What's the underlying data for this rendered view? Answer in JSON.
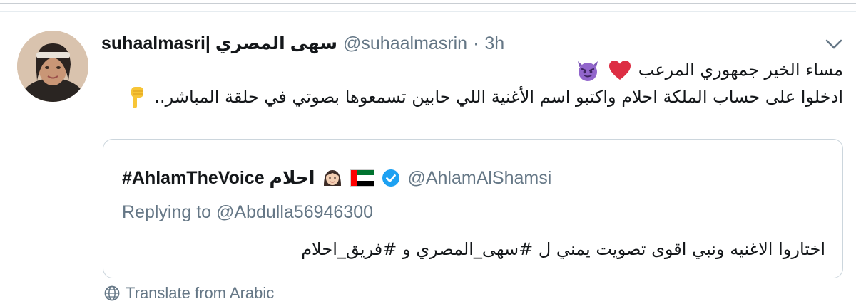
{
  "tweet": {
    "display_name": "suhaalmasri| سهى المصري",
    "handle": "@suhaalmasrin",
    "separator": "·",
    "time": "3h",
    "line1": "مساء الخير جمهوري المرعب",
    "line2": "ادخلوا على حساب الملكة احلام واكتبو اسم الأغنية اللي حابين تسمعوها بصوتي في حلقة المباشر..",
    "menu_icon": "chevron-down-icon"
  },
  "quoted": {
    "name": "#AhlamTheVoice احلام",
    "handle": "@AhlamAlShamsi",
    "replying_to": "Replying to @Abdulla56946300",
    "text": "اختاروا الاغنيه ونبي اقوى تصويت يمني ل #سهى_المصري و #فريق_احلام",
    "icons": [
      "woman-emoji-icon",
      "uae-flag-icon",
      "verified-badge-icon"
    ]
  },
  "translate": {
    "label": "Translate from Arabic",
    "icon": "globe-icon"
  },
  "colors": {
    "text": "#14171a",
    "muted": "#657786",
    "border": "#ccd6dd",
    "verified": "#1da1f2",
    "heart": "#e0245e",
    "devil": "#8e6ac8"
  }
}
